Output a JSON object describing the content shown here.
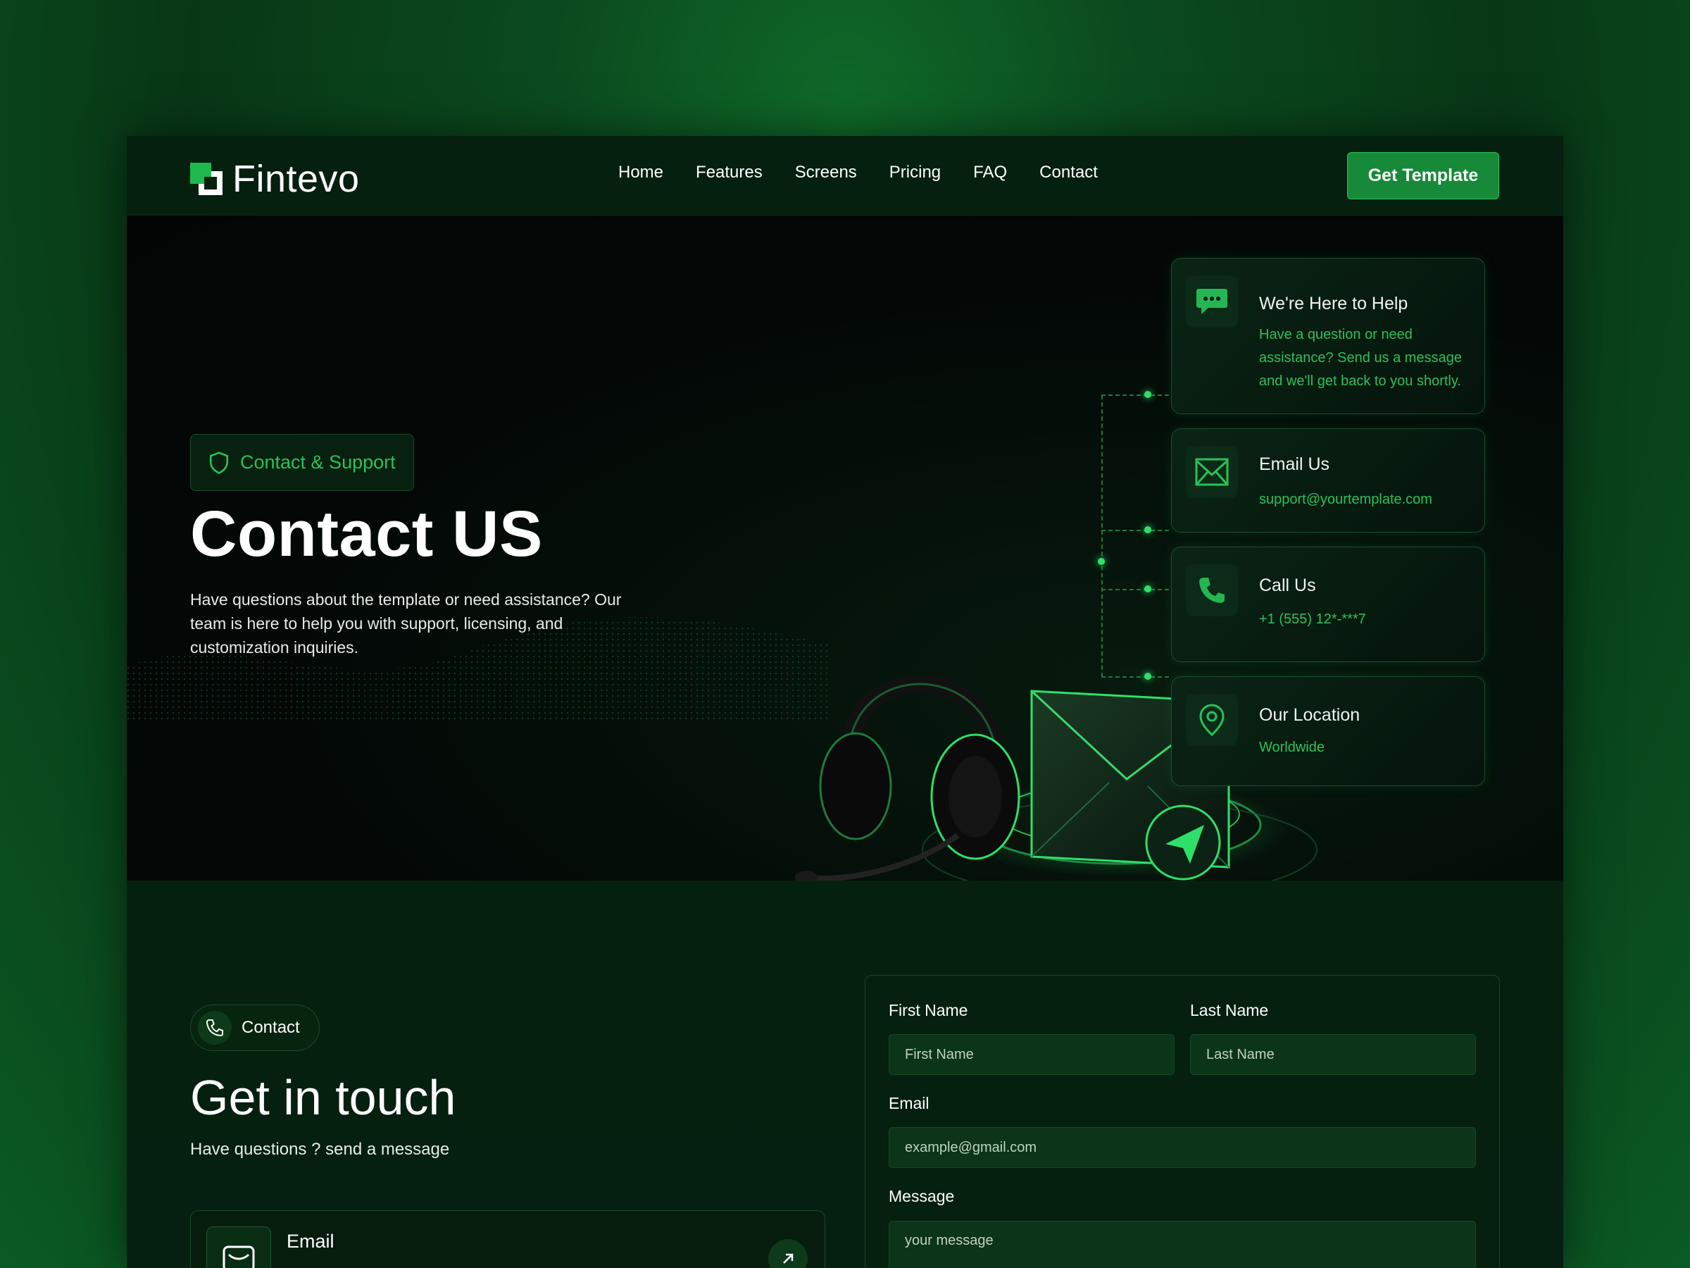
{
  "nav": {
    "brand": "Fintevo",
    "links": [
      "Home",
      "Features",
      "Screens",
      "Pricing",
      "FAQ",
      "Contact"
    ],
    "cta": "Get Template"
  },
  "hero": {
    "badge": "Contact & Support",
    "title": "Contact US",
    "description": "Have questions about the template or need assistance? Our team is here to help you with support, licensing, and customization inquiries.",
    "cards": [
      {
        "title": "We're Here to Help",
        "text": "Have a question or need assistance? Send us a message and we'll get back to you shortly.",
        "icon": "chat-icon"
      },
      {
        "title": "Email Us",
        "text": "support@yourtemplate.com",
        "icon": "mail-icon"
      },
      {
        "title": "Call Us",
        "text": "+1 (555) 12*-***7",
        "icon": "phone-icon"
      },
      {
        "title": "Our Location",
        "text": "Worldwide",
        "icon": "location-icon"
      }
    ]
  },
  "contact": {
    "pill": "Contact",
    "title": "Get in touch",
    "subtitle": "Have questions ? send a message",
    "email_card_label": "Email"
  },
  "form": {
    "first_name_label": "First Name",
    "first_name_placeholder": "First Name",
    "last_name_label": "Last Name",
    "last_name_placeholder": "Last Name",
    "email_label": "Email",
    "email_placeholder": "example@gmail.com",
    "message_label": "Message",
    "message_placeholder": "your message"
  },
  "colors": {
    "accent": "#1fb84f",
    "accent_text": "#2fbf5f",
    "button": "#178a3a"
  }
}
